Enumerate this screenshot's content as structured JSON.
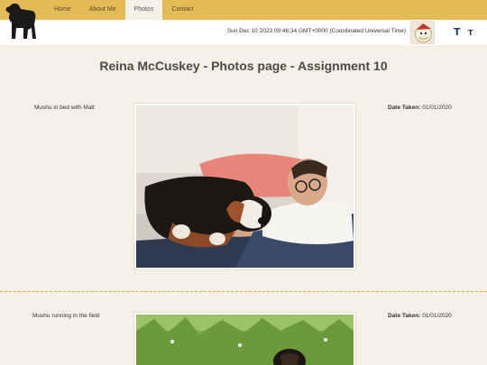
{
  "nav": {
    "items": [
      {
        "label": "Home",
        "active": false
      },
      {
        "label": "About Me",
        "active": false
      },
      {
        "label": "Photos",
        "active": true
      },
      {
        "label": "Contact",
        "active": false
      }
    ]
  },
  "header": {
    "datetime": "Sun Dec 10 2023 09:46:34 GMT+0000 (Coordinated Universal Time)",
    "font_large": "T",
    "font_small": "T",
    "accent_color": "#e3bb57"
  },
  "page": {
    "title": "Reina McCuskey - Photos page - Assignment 10"
  },
  "photos": [
    {
      "caption": "Mushu in bed with Matt",
      "date_label": "Date Taken:",
      "date_value": "01/01/2020"
    },
    {
      "caption": "Mushu running in the field",
      "date_label": "Date Taken:",
      "date_value": "01/01/2020"
    }
  ]
}
